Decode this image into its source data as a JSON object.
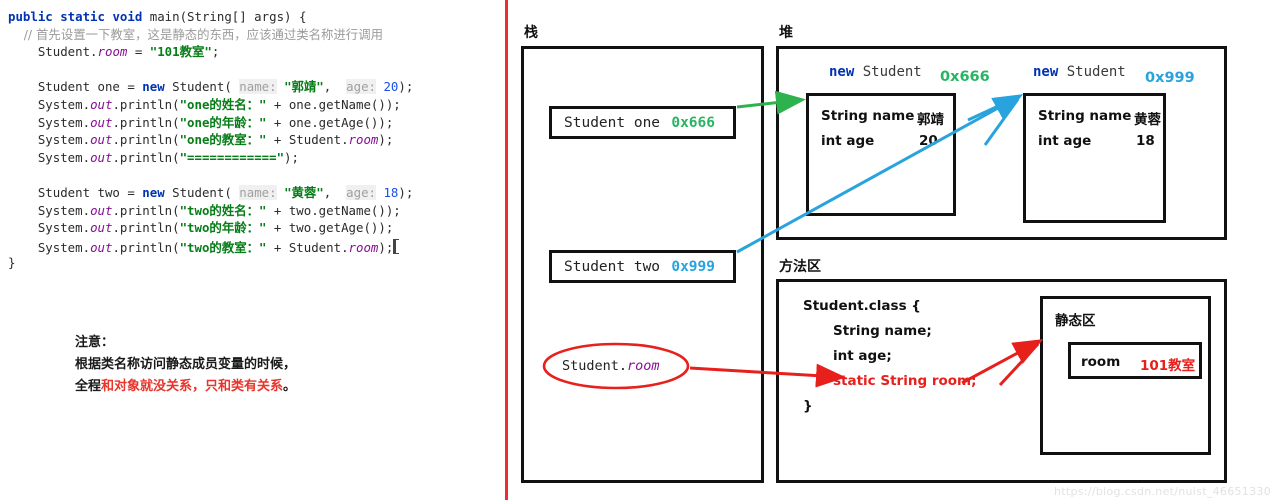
{
  "code": {
    "lines": [
      [
        {
          "t": "public ",
          "c": "kw"
        },
        {
          "t": "static ",
          "c": "kw"
        },
        {
          "t": "void ",
          "c": "kw"
        },
        {
          "t": "main(String[] args) {",
          "c": "ident"
        }
      ],
      [
        {
          "t": "    // 首先设置一下教室，这是静态的东西，应该通过类名称进行调用",
          "c": "cmt"
        }
      ],
      [
        {
          "t": "    Student.",
          "c": "ident"
        },
        {
          "t": "room",
          "c": "field"
        },
        {
          "t": " = ",
          "c": "ident"
        },
        {
          "t": "\"101教室\"",
          "c": "str"
        },
        {
          "t": ";",
          "c": "ident"
        }
      ],
      [
        {
          "t": "",
          "c": "ident"
        }
      ],
      [
        {
          "t": "    Student one = ",
          "c": "ident"
        },
        {
          "t": "new",
          "c": "kw"
        },
        {
          "t": " Student( ",
          "c": "ident"
        },
        {
          "t": "name:",
          "c": "hint"
        },
        {
          "t": " ",
          "c": "ident"
        },
        {
          "t": "\"郭靖\"",
          "c": "str"
        },
        {
          "t": ",  ",
          "c": "ident"
        },
        {
          "t": "age:",
          "c": "hint"
        },
        {
          "t": " ",
          "c": "ident"
        },
        {
          "t": "20",
          "c": "num"
        },
        {
          "t": ");",
          "c": "ident"
        }
      ],
      [
        {
          "t": "    System.",
          "c": "ident"
        },
        {
          "t": "out",
          "c": "field"
        },
        {
          "t": ".println(",
          "c": "ident"
        },
        {
          "t": "\"one的姓名：\"",
          "c": "str"
        },
        {
          "t": " + one.getName());",
          "c": "ident"
        }
      ],
      [
        {
          "t": "    System.",
          "c": "ident"
        },
        {
          "t": "out",
          "c": "field"
        },
        {
          "t": ".println(",
          "c": "ident"
        },
        {
          "t": "\"one的年龄：\"",
          "c": "str"
        },
        {
          "t": " + one.getAge());",
          "c": "ident"
        }
      ],
      [
        {
          "t": "    System.",
          "c": "ident"
        },
        {
          "t": "out",
          "c": "field"
        },
        {
          "t": ".println(",
          "c": "ident"
        },
        {
          "t": "\"one的教室：\"",
          "c": "str"
        },
        {
          "t": " + Student.",
          "c": "ident"
        },
        {
          "t": "room",
          "c": "field"
        },
        {
          "t": ");",
          "c": "ident"
        }
      ],
      [
        {
          "t": "    System.",
          "c": "ident"
        },
        {
          "t": "out",
          "c": "field"
        },
        {
          "t": ".println(",
          "c": "ident"
        },
        {
          "t": "\"============\"",
          "c": "str"
        },
        {
          "t": ");",
          "c": "ident"
        }
      ],
      [
        {
          "t": "",
          "c": "ident"
        }
      ],
      [
        {
          "t": "    Student two = ",
          "c": "ident"
        },
        {
          "t": "new",
          "c": "kw"
        },
        {
          "t": " Student( ",
          "c": "ident"
        },
        {
          "t": "name:",
          "c": "hint"
        },
        {
          "t": " ",
          "c": "ident"
        },
        {
          "t": "\"黄蓉\"",
          "c": "str"
        },
        {
          "t": ",  ",
          "c": "ident"
        },
        {
          "t": "age:",
          "c": "hint"
        },
        {
          "t": " ",
          "c": "ident"
        },
        {
          "t": "18",
          "c": "num"
        },
        {
          "t": ");",
          "c": "ident"
        }
      ],
      [
        {
          "t": "    System.",
          "c": "ident"
        },
        {
          "t": "out",
          "c": "field"
        },
        {
          "t": ".println(",
          "c": "ident"
        },
        {
          "t": "\"two的姓名：\"",
          "c": "str"
        },
        {
          "t": " + two.getName());",
          "c": "ident"
        }
      ],
      [
        {
          "t": "    System.",
          "c": "ident"
        },
        {
          "t": "out",
          "c": "field"
        },
        {
          "t": ".println(",
          "c": "ident"
        },
        {
          "t": "\"two的年龄：\"",
          "c": "str"
        },
        {
          "t": " + two.getAge());",
          "c": "ident"
        }
      ],
      [
        {
          "t": "    System.",
          "c": "ident"
        },
        {
          "t": "out",
          "c": "field"
        },
        {
          "t": ".println(",
          "c": "ident"
        },
        {
          "t": "\"two的教室：\"",
          "c": "str"
        },
        {
          "t": " + Student.",
          "c": "ident"
        },
        {
          "t": "room",
          "c": "field"
        },
        {
          "t": ");",
          "c": "ident",
          "caret": true
        }
      ],
      [
        {
          "t": "}",
          "c": "ident"
        }
      ]
    ]
  },
  "note": {
    "title": "注意：",
    "line2": "根据类名称访问静态成员变量的时候，",
    "line3_black": "全程",
    "line3_red": "和对象就没关系，只和类有关系",
    "line3_end": "。"
  },
  "memory": {
    "stack_label": "栈",
    "heap_label": "堆",
    "method_area_label": "方法区",
    "static_area_label": "静态区",
    "stack_frames": [
      {
        "name": "Student one",
        "address": "0x666",
        "color": "#28b463"
      },
      {
        "name": "Student two",
        "address": "0x999",
        "color": "#29a3dd"
      }
    ],
    "heap_objects": [
      {
        "title_new": "new",
        "title_class": "Student",
        "address": "0x666",
        "address_color": "#28b463",
        "fields": [
          {
            "decl": "String name",
            "value": "郭靖"
          },
          {
            "decl": "int age",
            "value": "20"
          }
        ]
      },
      {
        "title_new": "new",
        "title_class": "Student",
        "address": "0x999",
        "address_color": "#29a3dd",
        "fields": [
          {
            "decl": "String name",
            "value": "黄蓉"
          },
          {
            "decl": "int age",
            "value": "18"
          }
        ]
      }
    ],
    "class_block": {
      "header": "Student.class {",
      "field1": "String name;",
      "field2": "int age;",
      "field3_static": "static String room;",
      "footer": "}"
    },
    "static_entry": {
      "key": "room",
      "value": "101教室"
    },
    "annotation_ellipse": {
      "prefix": "Student.",
      "field": "room"
    }
  },
  "watermark": "https://blog.csdn.net/nuist_46651330",
  "colors": {
    "divider_red": "#ee2b36",
    "arrow_green": "#2eb24e",
    "arrow_blue": "#29a3dd",
    "arrow_red": "#e8201c",
    "box_border": "#111111"
  }
}
